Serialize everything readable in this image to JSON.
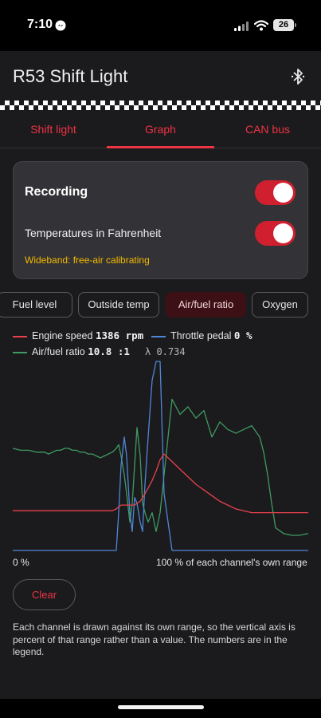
{
  "status": {
    "time": "7:10",
    "battery": "26"
  },
  "app": {
    "title": "R53 Shift Light"
  },
  "tabs": [
    {
      "label": "Shift light",
      "selected": false
    },
    {
      "label": "Graph",
      "selected": true
    },
    {
      "label": "CAN bus",
      "selected": false
    }
  ],
  "settings": {
    "recording_label": "Recording",
    "recording_on": true,
    "fahrenheit_label": "Temperatures in Fahrenheit",
    "fahrenheit_on": true,
    "calibration_status": "Wideband: free-air calibrating"
  },
  "channel_chips": [
    {
      "label": "Fuel level",
      "selected": false
    },
    {
      "label": "Outside temp",
      "selected": false
    },
    {
      "label": "Air/fuel ratio",
      "selected": true
    },
    {
      "label": "Oxygen",
      "selected": false
    }
  ],
  "legend": {
    "engine_speed": {
      "label": "Engine speed",
      "value": "1386 rpm",
      "color": "#e8414c"
    },
    "throttle": {
      "label": "Throttle pedal",
      "value": "0 %",
      "color": "#4f86d6"
    },
    "afr": {
      "label": "Air/fuel ratio",
      "value": "10.8 :1",
      "color": "#3f9a62"
    },
    "lambda": "λ 0.734"
  },
  "axis": {
    "min_label": "0 %",
    "max_label": "100 % of each channel's own range"
  },
  "chart_data": {
    "type": "line",
    "x": [
      0,
      10,
      20,
      30,
      40,
      45,
      50,
      55,
      60,
      65,
      70,
      75,
      80,
      85,
      90,
      95,
      100,
      105,
      110,
      115,
      120,
      125,
      130,
      133,
      136,
      140,
      143,
      147,
      150,
      153,
      156,
      160,
      163,
      166,
      170,
      175,
      180,
      185,
      190,
      200,
      210,
      220,
      230,
      240,
      250,
      260,
      270,
      280,
      290,
      300,
      310,
      315,
      320,
      325,
      330,
      340,
      350,
      360,
      371
    ],
    "series": [
      {
        "name": "Engine speed",
        "color": "#e8414c",
        "values": [
          21,
          21,
          21,
          21,
          21,
          21,
          21,
          21,
          21,
          21,
          21,
          21,
          21,
          21,
          21,
          21,
          21,
          21,
          21,
          21,
          21,
          21,
          22,
          23,
          24,
          24,
          24,
          24,
          24,
          24,
          25,
          26,
          28,
          30,
          33,
          37,
          42,
          48,
          51,
          47,
          43,
          39,
          35,
          32,
          29,
          26,
          24,
          22,
          21,
          20,
          20,
          20,
          20,
          20,
          20,
          20,
          20,
          20,
          20
        ]
      },
      {
        "name": "Throttle pedal",
        "color": "#4f86d6",
        "values": [
          0,
          0,
          0,
          0,
          0,
          0,
          0,
          0,
          0,
          0,
          0,
          0,
          0,
          0,
          0,
          0,
          0,
          0,
          0,
          0,
          0,
          0,
          0,
          20,
          45,
          60,
          50,
          20,
          10,
          28,
          25,
          15,
          10,
          35,
          60,
          90,
          100,
          100,
          30,
          0,
          0,
          0,
          0,
          0,
          0,
          0,
          0,
          0,
          0,
          0,
          0,
          0,
          0,
          0,
          0,
          0,
          0,
          0,
          0
        ]
      },
      {
        "name": "Air/fuel ratio",
        "color": "#3f9a62",
        "values": [
          54,
          53,
          53,
          52,
          52,
          51,
          52,
          53,
          53,
          54,
          54,
          53,
          53,
          52,
          52,
          51,
          51,
          50,
          49,
          50,
          51,
          52,
          54,
          56,
          50,
          40,
          30,
          15,
          25,
          45,
          65,
          50,
          25,
          20,
          15,
          20,
          10,
          20,
          40,
          80,
          72,
          76,
          70,
          74,
          60,
          68,
          64,
          62,
          64,
          66,
          60,
          52,
          40,
          25,
          12,
          9,
          8,
          8,
          9
        ]
      }
    ],
    "xlabel": "",
    "ylabel": "",
    "ylim": [
      0,
      100
    ],
    "grid": false
  }
}
